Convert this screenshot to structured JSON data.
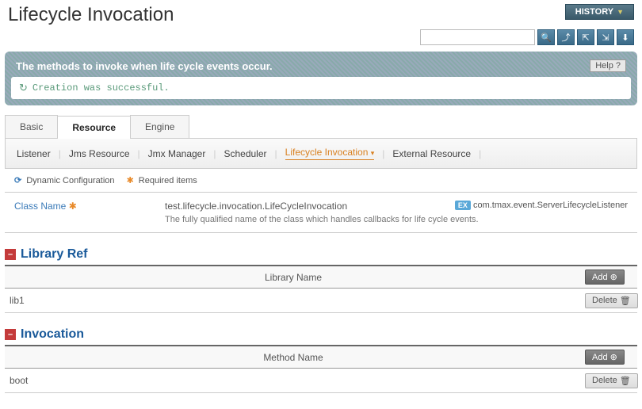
{
  "header": {
    "title": "Lifecycle Invocation",
    "history_label": "HISTORY"
  },
  "search": {
    "placeholder": ""
  },
  "info": {
    "text": "The methods to invoke when life cycle events occur.",
    "help_label": "Help ?",
    "message": "Creation was successful."
  },
  "tabs": [
    {
      "label": "Basic",
      "active": false
    },
    {
      "label": "Resource",
      "active": true
    },
    {
      "label": "Engine",
      "active": false
    }
  ],
  "subtabs": [
    {
      "label": "Listener",
      "active": false
    },
    {
      "label": "Jms Resource",
      "active": false
    },
    {
      "label": "Jmx Manager",
      "active": false
    },
    {
      "label": "Scheduler",
      "active": false
    },
    {
      "label": "Lifecycle Invocation",
      "active": true,
      "dropdown": true
    },
    {
      "label": "External Resource",
      "active": false
    }
  ],
  "legend": {
    "dynamic": "Dynamic Configuration",
    "required": "Required items"
  },
  "class_field": {
    "label": "Class Name",
    "value": "test.lifecycle.invocation.LifeCycleInvocation",
    "example": "com.tmax.event.ServerLifecycleListener",
    "description": "The fully qualified name of the class which handles callbacks for life cycle events."
  },
  "library_ref": {
    "title": "Library Ref",
    "column": "Library Name",
    "add_label": "Add",
    "rows": [
      {
        "name": "lib1",
        "delete_label": "Delete"
      }
    ]
  },
  "invocation": {
    "title": "Invocation",
    "column": "Method Name",
    "add_label": "Add",
    "rows": [
      {
        "name": "boot",
        "delete_label": "Delete"
      }
    ]
  }
}
